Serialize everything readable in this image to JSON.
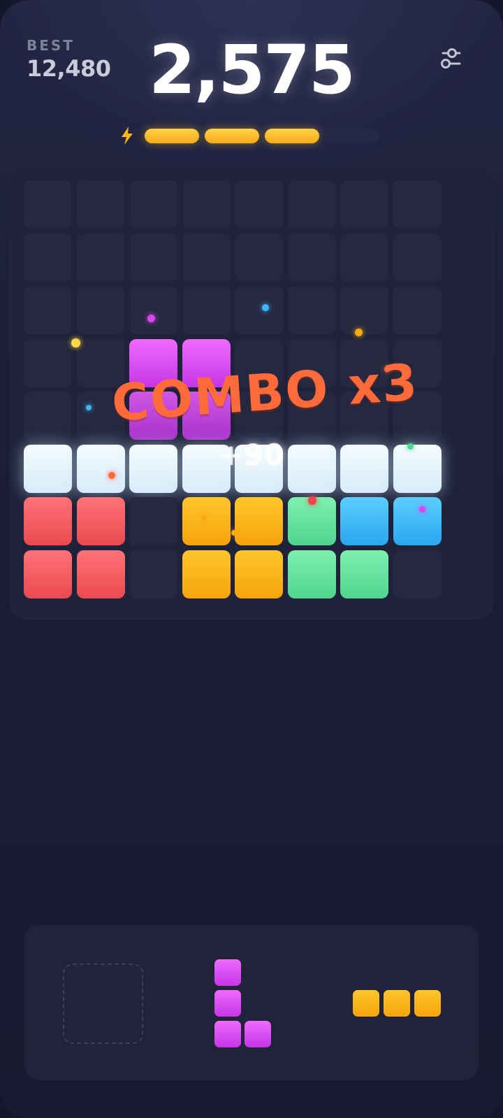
{
  "header": {
    "best_label": "BEST",
    "best_value": "12,480",
    "score": "2,575",
    "settings_icon": "sliders-icon"
  },
  "power_meter": {
    "icon": "lightning-bolt-icon",
    "segments_total": 4,
    "segments_filled": 3,
    "fill_color": "#f9b71a"
  },
  "board": {
    "columns": 8,
    "rows": 8,
    "colors": {
      "red": "#f05a5f",
      "yellow": "#f8b21a",
      "green": "#63e09c",
      "blue": "#3bb6f6",
      "purple": "#d94cf2",
      "cleared": "#e8f4fc"
    },
    "rows_state": [
      [
        "",
        "",
        "",
        "",
        "",
        "",
        "",
        ""
      ],
      [
        "",
        "",
        "",
        "",
        "",
        "",
        "",
        ""
      ],
      [
        "",
        "",
        "",
        "",
        "",
        "",
        "",
        ""
      ],
      [
        "",
        "",
        "purple",
        "purple",
        "",
        "",
        "",
        ""
      ],
      [
        "",
        "",
        "purple",
        "purple",
        "",
        "",
        "",
        ""
      ],
      [
        "cleared",
        "cleared",
        "cleared",
        "cleared",
        "cleared",
        "cleared",
        "cleared",
        "cleared"
      ],
      [
        "red",
        "red",
        "",
        "yellow",
        "yellow",
        "green",
        "blue",
        "blue"
      ],
      [
        "red",
        "red",
        "",
        "yellow",
        "yellow",
        "green",
        "green",
        ""
      ]
    ]
  },
  "effects": {
    "combo_text": "COMBO x3",
    "points_popup": "+90"
  },
  "tray": {
    "slots": [
      {
        "state": "empty"
      },
      {
        "color": "purple",
        "shape": "L",
        "cells": 4
      },
      {
        "color": "yellow",
        "shape": "line-3",
        "cells": 3
      }
    ]
  }
}
